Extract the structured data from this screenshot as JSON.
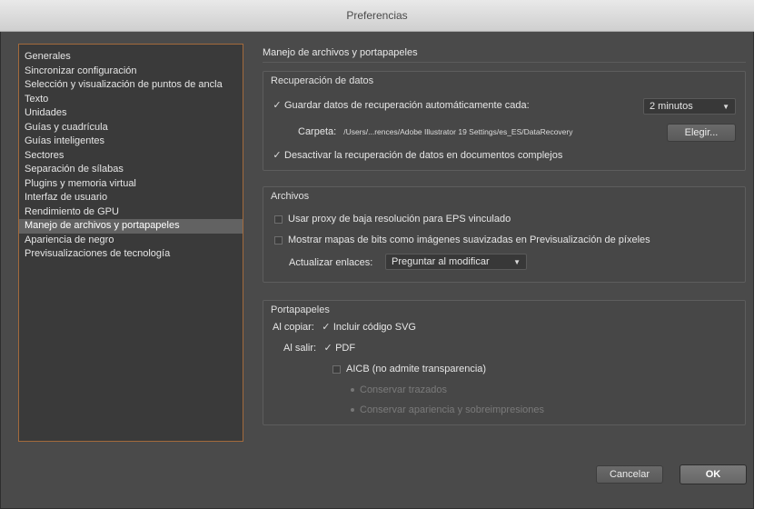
{
  "window": {
    "title": "Preferencias"
  },
  "sidebar": {
    "items": [
      {
        "label": "Generales"
      },
      {
        "label": "Sincronizar configuración"
      },
      {
        "label": "Selección y visualización de puntos de ancla"
      },
      {
        "label": "Texto"
      },
      {
        "label": "Unidades"
      },
      {
        "label": "Guías y cuadrícula"
      },
      {
        "label": "Guías inteligentes"
      },
      {
        "label": "Sectores"
      },
      {
        "label": "Separación de sílabas"
      },
      {
        "label": "Plugins y memoria virtual"
      },
      {
        "label": "Interfaz de usuario"
      },
      {
        "label": "Rendimiento de GPU"
      },
      {
        "label": "Manejo de archivos y portapapeles"
      },
      {
        "label": "Apariencia de negro"
      },
      {
        "label": "Previsualizaciones de tecnología"
      }
    ],
    "selected_index": 12
  },
  "main": {
    "title": "Manejo de archivos y portapapeles",
    "recovery": {
      "group_label": "Recuperación de datos",
      "autosave_label": "Guardar datos de recuperación automáticamente cada:",
      "autosave_checked": true,
      "interval_value": "2 minutos",
      "folder_label": "Carpeta:",
      "folder_path": "/Users/...rences/Adobe Illustrator 19 Settings/es_ES/DataRecovery",
      "choose_button": "Elegir...",
      "disable_complex_label": "Desactivar la recuperación de datos en documentos complejos",
      "disable_complex_checked": true
    },
    "files": {
      "group_label": "Archivos",
      "proxy_label": "Usar proxy de baja resolución para EPS vinculado",
      "proxy_checked": false,
      "bitmap_label": "Mostrar mapas de bits como imágenes suavizadas en Previsualización de píxeles",
      "bitmap_checked": false,
      "update_links_label": "Actualizar enlaces:",
      "update_links_value": "Preguntar al modificar"
    },
    "clipboard": {
      "group_label": "Portapapeles",
      "on_copy_label": "Al copiar:",
      "svg_label": "Incluir código SVG",
      "svg_checked": true,
      "on_quit_label": "Al salir:",
      "pdf_label": "PDF",
      "pdf_checked": true,
      "aicb_label": "AICB (no admite transparencia)",
      "aicb_checked": false,
      "preserve_paths_label": "Conservar trazados",
      "preserve_appearance_label": "Conservar apariencia y sobreimpresiones"
    }
  },
  "footer": {
    "cancel_label": "Cancelar",
    "ok_label": "OK"
  },
  "icons": {
    "checkmark": "checkmark-icon",
    "dropdown": "chevron-down-icon"
  }
}
